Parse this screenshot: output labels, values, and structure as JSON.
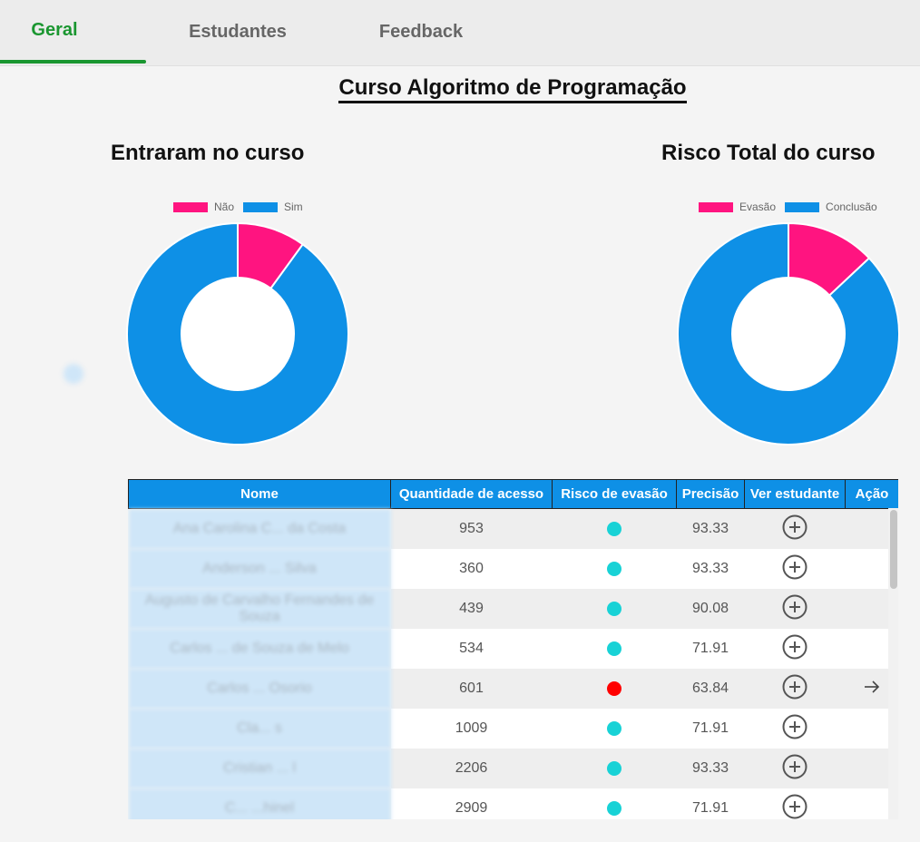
{
  "tabs": [
    {
      "label": "Geral",
      "active": true
    },
    {
      "label": "Estudantes",
      "active": false
    },
    {
      "label": "Feedback",
      "active": false
    }
  ],
  "course_title": "Curso Algoritmo de Programação",
  "colors": {
    "accent_green": "#1a9630",
    "pink": "#ff1480",
    "blue": "#0e90e6",
    "risk_low": "#18d2d6",
    "risk_high": "#ff0000"
  },
  "charts": {
    "entered": {
      "title": "Entraram no curso",
      "legend": [
        "Não",
        "Sim"
      ],
      "values": [
        10,
        90
      ]
    },
    "risk": {
      "title": "Risco Total do curso",
      "legend": [
        "Evasão",
        "Conclusão"
      ],
      "values": [
        13,
        87
      ]
    }
  },
  "table": {
    "headers": [
      "Nome",
      "Quantidade de acesso",
      "Risco de evasão",
      "Precisão",
      "Ver estudante",
      "Ação"
    ],
    "rows": [
      {
        "name": "Ana Carolina C... da Costa",
        "access": "953",
        "risk": "low",
        "precision": "93.33",
        "action": false
      },
      {
        "name": "Anderson ... Silva",
        "access": "360",
        "risk": "low",
        "precision": "93.33",
        "action": false
      },
      {
        "name": "Augusto de Carvalho Fernandes de Souza",
        "access": "439",
        "risk": "low",
        "precision": "90.08",
        "action": false
      },
      {
        "name": "Carlos ... de Souza de Melo",
        "access": "534",
        "risk": "low",
        "precision": "71.91",
        "action": false
      },
      {
        "name": "Carlos ... Osorio",
        "access": "601",
        "risk": "high",
        "precision": "63.84",
        "action": true
      },
      {
        "name": "Cla... s",
        "access": "1009",
        "risk": "low",
        "precision": "71.91",
        "action": false
      },
      {
        "name": "Cristian ... l",
        "access": "2206",
        "risk": "low",
        "precision": "93.33",
        "action": false
      },
      {
        "name": "C... ...hinel",
        "access": "2909",
        "risk": "low",
        "precision": "71.91",
        "action": false
      }
    ]
  }
}
